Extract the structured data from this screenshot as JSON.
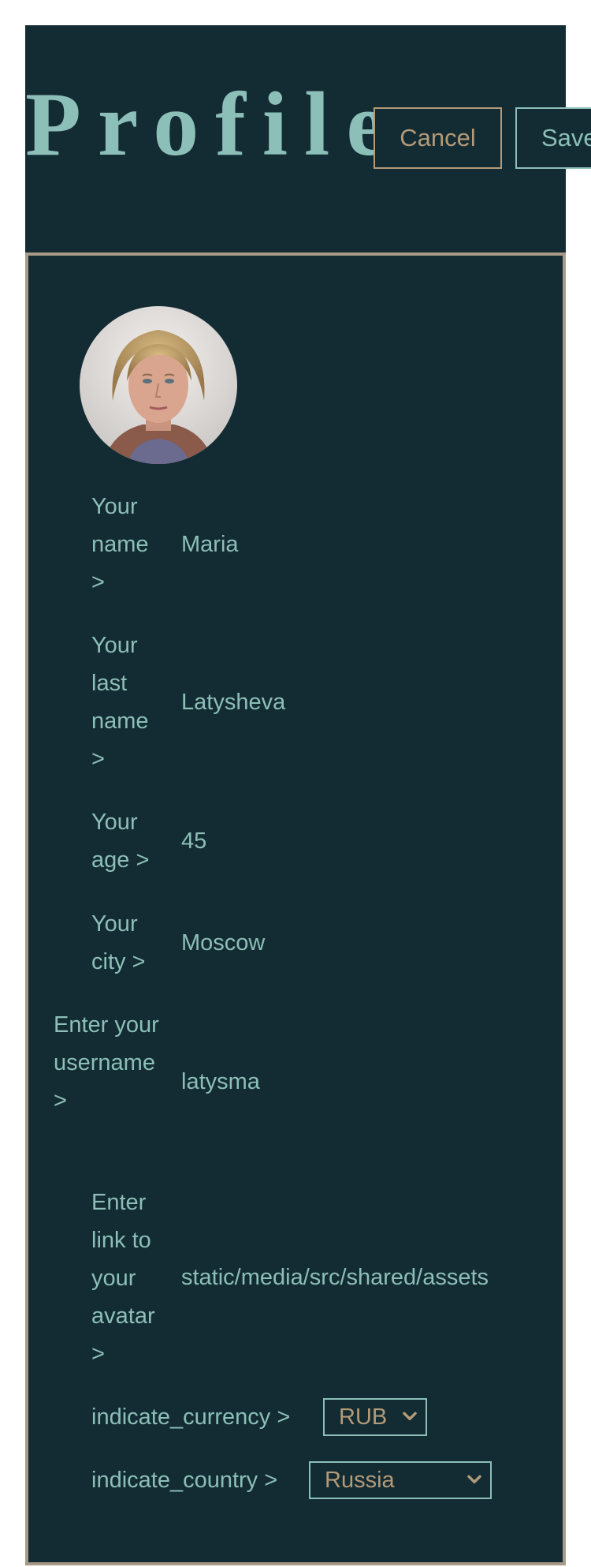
{
  "header": {
    "title": "Profile",
    "cancel_label": "Cancel",
    "save_label": "Save"
  },
  "fields": {
    "name": {
      "label": "Your name >",
      "value": "Maria"
    },
    "last_name": {
      "label": "Your last name >",
      "value": "Latysheva"
    },
    "age": {
      "label": "Your age >",
      "value": "45"
    },
    "city": {
      "label": "Your city >",
      "value": "Moscow"
    },
    "username": {
      "label": "Enter your username >",
      "value": "latysma"
    },
    "avatar_link": {
      "label": "Enter link to your avatar >",
      "value": "static/media/src/shared/assets"
    }
  },
  "currency": {
    "label": "indicate_currency >",
    "selected": "RUB"
  },
  "country": {
    "label": "indicate_country >",
    "selected": "Russia"
  },
  "colors": {
    "background": "#132b32",
    "accent_teal": "#8cbfb8",
    "accent_tan": "#b39a78",
    "panel_border": "#a89a86"
  }
}
